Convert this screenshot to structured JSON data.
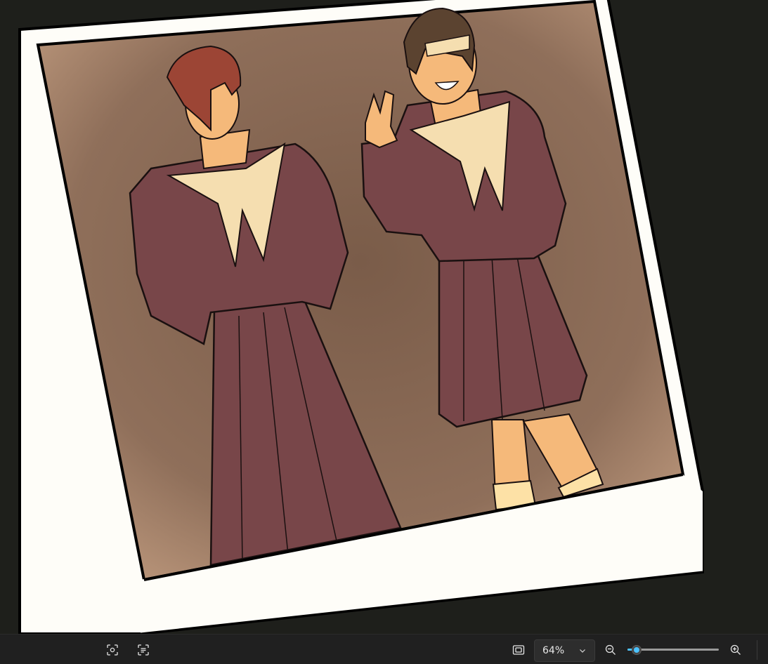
{
  "image": {
    "subject": "polaroid-photo",
    "colors": {
      "viewer_background": "#1e1f1b",
      "polaroid_frame": "#fefdf8",
      "photo_background": "#8a6a55",
      "uniform": "#784649",
      "scarf": "#f5deb0",
      "skin": "#f5b97a",
      "red_hair": "#9c4535",
      "brown_hair": "#5b4330"
    }
  },
  "toolbar": {
    "icons": {
      "visual_search": "visual-search-icon",
      "text_recognition": "text-recognition-icon",
      "fit_to_window": "fit-to-window-icon",
      "zoom_out": "zoom-out-icon",
      "zoom_in": "zoom-in-icon",
      "chevron": "chevron-down-icon"
    },
    "zoom_value": "64%",
    "zoom_slider_fraction": 0.1,
    "accent": "#4cc2ff"
  }
}
